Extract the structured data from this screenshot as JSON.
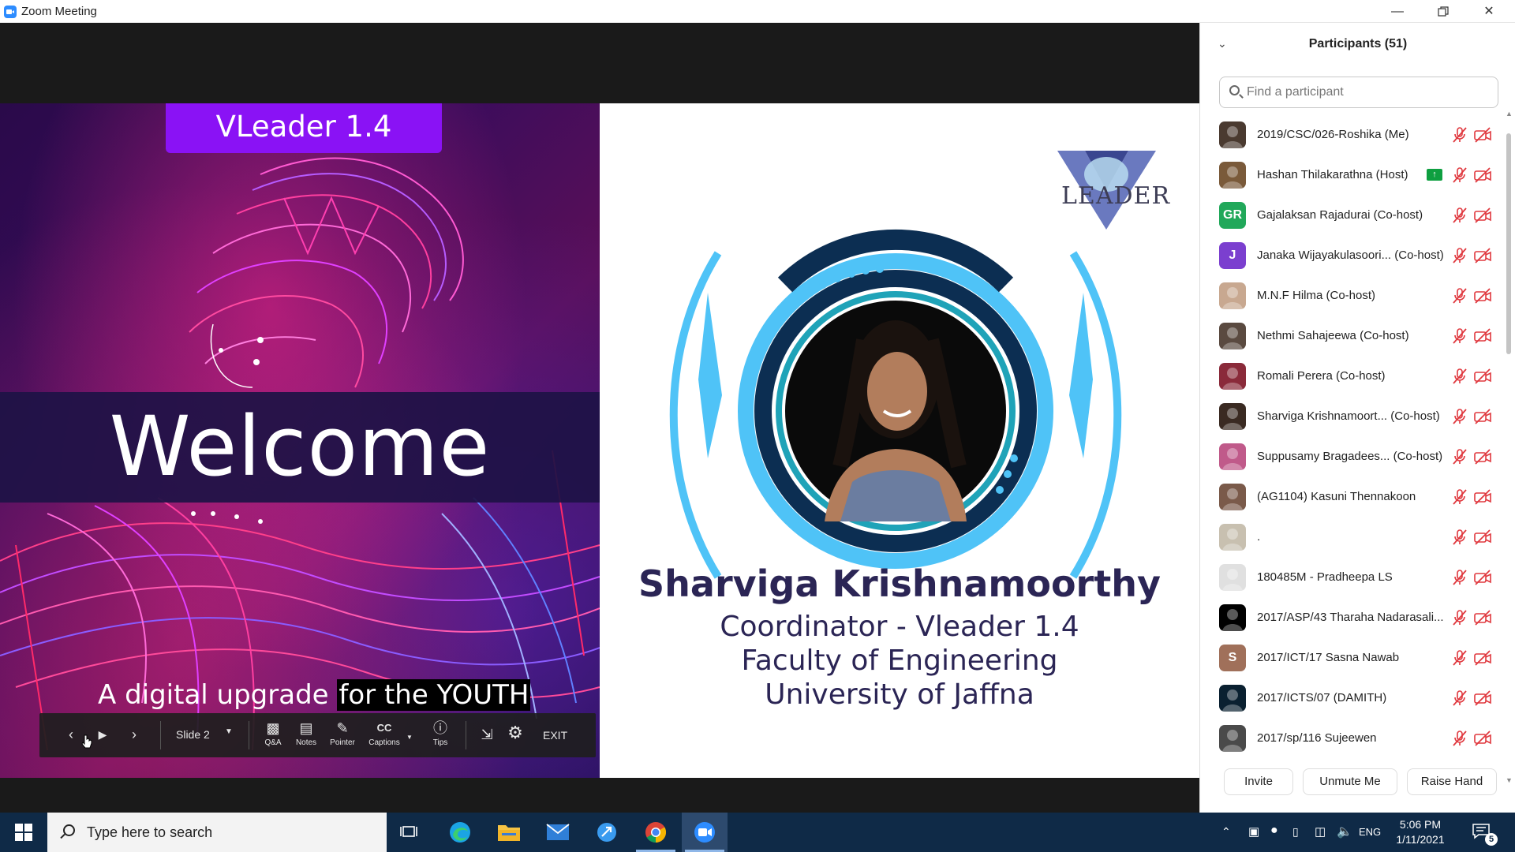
{
  "window": {
    "title": "Zoom Meeting",
    "controls": [
      "minimize",
      "restore",
      "close"
    ]
  },
  "slide": {
    "badge": "VLeader 1.4",
    "welcome": "Welcome",
    "tagline_part1": "A digital upgrade",
    "tagline_part2": "for the YOUTH",
    "logo_text": "LEADER",
    "person": {
      "name": "Sharviga Krishnamoorthy",
      "line1": "Coordinator - Vleader 1.4",
      "line2": "Faculty of Engineering",
      "line3": "University of Jaffna"
    }
  },
  "slide_controls": {
    "slide_label": "Slide 2",
    "qa": "Q&A",
    "notes": "Notes",
    "pointer": "Pointer",
    "captions": "Captions",
    "tips": "Tips",
    "exit": "EXIT"
  },
  "participants_panel": {
    "title": "Participants (51)",
    "search_placeholder": "Find a participant",
    "participants": [
      {
        "name": "2019/CSC/026-Roshika (Me)",
        "avatar_type": "photo",
        "avatar_color": "#4a3a30",
        "sharing": false
      },
      {
        "name": "Hashan Thilakarathna (Host)",
        "avatar_type": "photo",
        "avatar_color": "#7a5a3a",
        "sharing": true
      },
      {
        "name": "Gajalaksan Rajadurai (Co-host)",
        "avatar_type": "initials",
        "initials": "GR",
        "avatar_color": "#21a85a",
        "sharing": false
      },
      {
        "name": "Janaka Wijayakulasoori... (Co-host)",
        "avatar_type": "initials",
        "initials": "J",
        "avatar_color": "#7b3fcf",
        "sharing": false
      },
      {
        "name": "M.N.F Hilma (Co-host)",
        "avatar_type": "photo",
        "avatar_color": "#c8a890",
        "sharing": false
      },
      {
        "name": "Nethmi Sahajeewa (Co-host)",
        "avatar_type": "photo",
        "avatar_color": "#5a4a40",
        "sharing": false
      },
      {
        "name": "Romali Perera (Co-host)",
        "avatar_type": "photo",
        "avatar_color": "#8a2a3a",
        "sharing": false
      },
      {
        "name": "Sharviga Krishnamoort... (Co-host)",
        "avatar_type": "photo",
        "avatar_color": "#3a2a22",
        "sharing": false
      },
      {
        "name": "Suppusamy Bragadees... (Co-host)",
        "avatar_type": "photo",
        "avatar_color": "#c05a8a",
        "sharing": false
      },
      {
        "name": "(AG1104) Kasuni Thennakoon",
        "avatar_type": "photo",
        "avatar_color": "#7a5a4a",
        "sharing": false
      },
      {
        "name": ".",
        "avatar_type": "photo",
        "avatar_color": "#c8c0b0",
        "sharing": false
      },
      {
        "name": "180485M - Pradheepa LS",
        "avatar_type": "photo",
        "avatar_color": "#e0e0e0",
        "sharing": false
      },
      {
        "name": "2017/ASP/43 Tharaha Nadarasali...",
        "avatar_type": "photo",
        "avatar_color": "#000000",
        "sharing": false
      },
      {
        "name": "2017/ICT/17 Sasna Nawab",
        "avatar_type": "initials",
        "initials": "S",
        "avatar_color": "#a0705a",
        "sharing": false
      },
      {
        "name": "2017/ICTS/07 (DAMITH)",
        "avatar_type": "photo",
        "avatar_color": "#0a2030",
        "sharing": false
      },
      {
        "name": "2017/sp/116 Sujeewen",
        "avatar_type": "photo",
        "avatar_color": "#4a4a4a",
        "sharing": false
      }
    ],
    "buttons": {
      "invite": "Invite",
      "unmute": "Unmute Me",
      "raise_hand": "Raise Hand"
    }
  },
  "taskbar": {
    "search_placeholder": "Type here to search",
    "apps": [
      "task-view",
      "edge",
      "file-explorer",
      "mail",
      "app-blue",
      "chrome",
      "zoom"
    ],
    "tray": {
      "language": "ENG",
      "time": "5:06 PM",
      "date": "1/11/2021",
      "notification_count": "5"
    }
  },
  "colors": {
    "badge_purple": "#8a12f5",
    "name_navy": "#2b2555",
    "mute_red": "#e0383e",
    "taskbar": "#0f2a47"
  }
}
